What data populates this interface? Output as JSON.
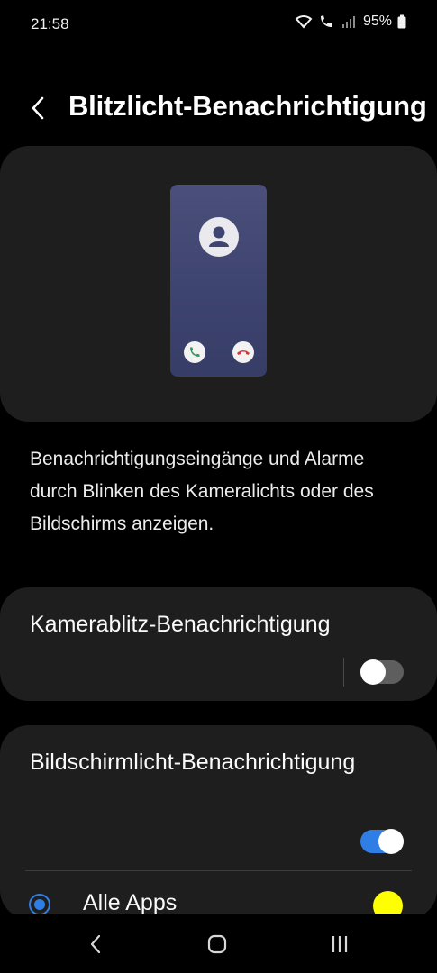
{
  "status_bar": {
    "time": "21:58",
    "battery": "95%",
    "icons": [
      "wifi-icon",
      "wifi-calling-icon",
      "signal-icon",
      "battery-icon"
    ]
  },
  "header": {
    "title": "Blitzlicht-Benachrichtigung",
    "back_icon": "back-chevron-icon"
  },
  "preview": {
    "icons": [
      "avatar-icon",
      "phone-accept-icon",
      "phone-decline-icon"
    ]
  },
  "description": "Benachrichtigungseingänge und Alarme durch Blinken des Kameralichts oder des Bildschirms anzeigen.",
  "camera_flash": {
    "label": "Kamerablitz-Benachrichtigung",
    "enabled": false
  },
  "screen_flash": {
    "label": "Bildschirmlicht-Benachrichtigung",
    "enabled": true,
    "option_label": "Alle Apps",
    "option_selected": true,
    "color": "#ffff00"
  },
  "colors": {
    "accent": "#2f7ee6",
    "card_bg": "#1e1e1e",
    "background": "#000000"
  },
  "navigation": {
    "icons": [
      "nav-back-icon",
      "nav-home-icon",
      "nav-recents-icon"
    ]
  }
}
